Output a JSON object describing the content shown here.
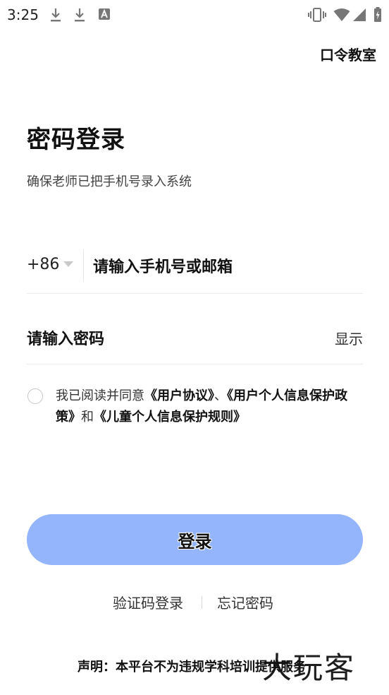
{
  "status_bar": {
    "time": "3:25"
  },
  "header": {
    "top_link": "口令教室"
  },
  "login": {
    "title": "密码登录",
    "subtitle": "确保老师已把手机号录入系统",
    "country_code": "+86",
    "phone_placeholder": "请输入手机号或邮箱",
    "password_placeholder": "请输入密码",
    "show_label": "显示",
    "agreement": {
      "prefix": "我已阅读并同意",
      "link1": "《用户协议》",
      "sep1": "、",
      "link2": "《用户个人信息保护政策》",
      "conj": "和",
      "link3": "《儿童个人信息保护规则》"
    },
    "login_button": "登录",
    "sms_login": "验证码登录",
    "forgot_password": "忘记密码"
  },
  "footer": {
    "disclaimer": "声明：本平台不为违规学科培训提供服务",
    "watermark": "大玩客"
  },
  "colors": {
    "button_bg": "#94b4fb",
    "divider": "#ececec"
  }
}
